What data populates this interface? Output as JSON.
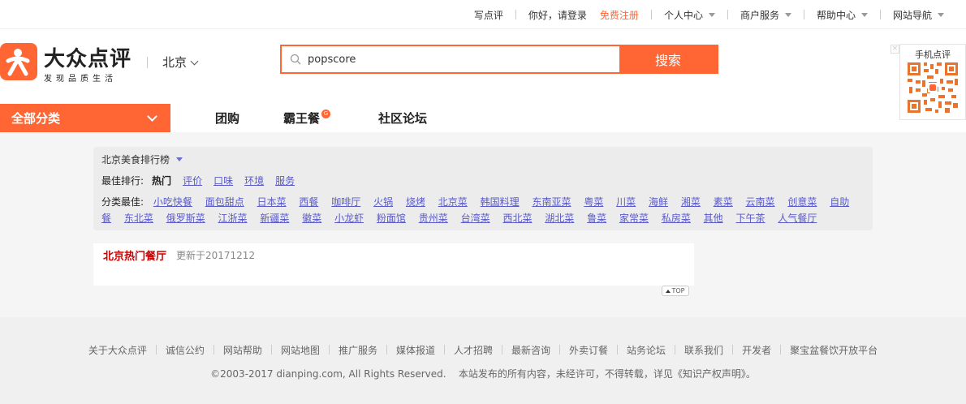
{
  "topbar": {
    "write_review": "写点评",
    "greeting": "你好，请登录",
    "register": "免费注册",
    "personal_center": "个人中心",
    "merchant_services": "商户服务",
    "help_center": "帮助中心",
    "site_nav": "网站导航"
  },
  "header": {
    "brand": "大众点评",
    "slogan": "发现品质生活",
    "city": "北京",
    "search_value": "popscore",
    "search_button": "搜索",
    "qr_title": "手机点评"
  },
  "nav": {
    "all_categories": "全部分类",
    "tabs": [
      "团购",
      "霸王餐",
      "社区论坛"
    ],
    "badge": "G"
  },
  "ranking": {
    "title": "北京美食排行榜",
    "best_label": "最佳排行:",
    "best_items": [
      "热门",
      "评价",
      "口味",
      "环境",
      "服务"
    ],
    "category_label": "分类最佳:",
    "categories": [
      "小吃快餐",
      "面包甜点",
      "日本菜",
      "西餐",
      "咖啡厅",
      "火锅",
      "烧烤",
      "北京菜",
      "韩国料理",
      "东南亚菜",
      "粤菜",
      "川菜",
      "海鲜",
      "湘菜",
      "素菜",
      "云南菜",
      "创意菜",
      "自助餐",
      "东北菜",
      "俄罗斯菜",
      "江浙菜",
      "新疆菜",
      "徽菜",
      "小龙虾",
      "粉面馆",
      "贵州菜",
      "台湾菜",
      "西北菜",
      "湖北菜",
      "鲁菜",
      "家常菜",
      "私房菜",
      "其他",
      "下午茶",
      "人气餐厅"
    ]
  },
  "hot": {
    "title": "北京热门餐厅",
    "updated": "更新于20171212"
  },
  "top_button": "TOP",
  "footer": {
    "links": [
      "关于大众点评",
      "诚信公约",
      "网站帮助",
      "网站地图",
      "推广服务",
      "媒体报道",
      "人才招聘",
      "最新咨询",
      "外卖订餐",
      "站务论坛",
      "联系我们",
      "开发者",
      "聚宝盆餐饮开放平台"
    ],
    "copyright": "©2003-2017 dianping.com, All Rights Reserved.    本站发布的所有内容，未经许可，不得转载，详见《知识产权声明》。"
  },
  "colors": {
    "brand": "#ff6633",
    "link": "#5a5ac8",
    "hot_title": "#cc0000"
  }
}
